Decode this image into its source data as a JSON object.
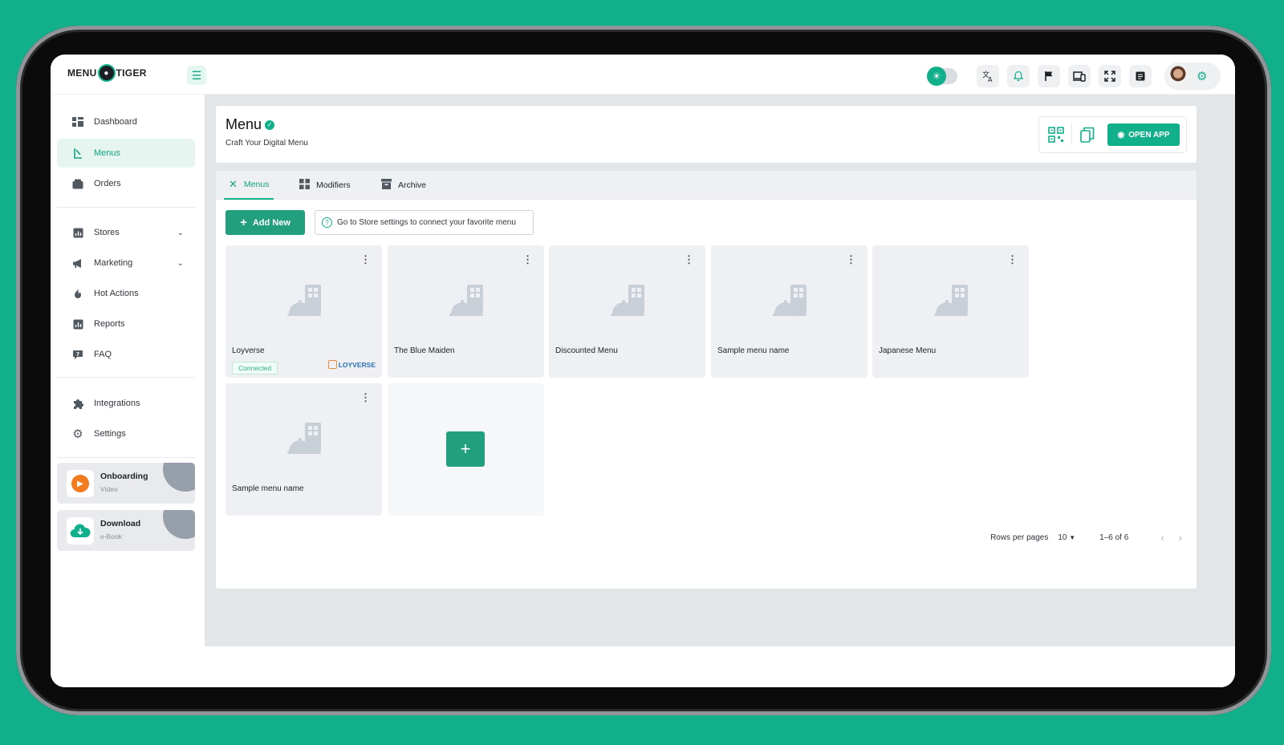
{
  "app": {
    "logo_left": "MENU",
    "logo_right": "TIGER"
  },
  "topbar": {
    "icons": [
      "theme-toggle",
      "translate-icon",
      "bell-icon",
      "flag-icon",
      "devices-icon",
      "fullscreen-icon",
      "notes-icon",
      "avatar",
      "gear-icon"
    ]
  },
  "sidebar": {
    "items": [
      {
        "label": "Dashboard",
        "icon": "dashboard-icon"
      },
      {
        "label": "Menus",
        "icon": "menu-book-icon",
        "active": true
      },
      {
        "label": "Orders",
        "icon": "orders-icon"
      },
      {
        "label": "Stores",
        "icon": "stores-icon",
        "expandable": true
      },
      {
        "label": "Marketing",
        "icon": "megaphone-icon",
        "expandable": true
      },
      {
        "label": "Hot Actions",
        "icon": "fire-icon"
      },
      {
        "label": "Reports",
        "icon": "reports-icon"
      },
      {
        "label": "FAQ",
        "icon": "faq-icon"
      },
      {
        "label": "Integrations",
        "icon": "puzzle-icon"
      },
      {
        "label": "Settings",
        "icon": "gear-icon"
      }
    ],
    "promos": [
      {
        "title": "Onboarding",
        "subtitle": "Video",
        "color": "#f47a20"
      },
      {
        "title": "Download",
        "subtitle": "e-Book",
        "color": "#12b08a"
      }
    ]
  },
  "header": {
    "title": "Menu",
    "subtitle": "Craft Your Digital Menu",
    "open_app_label": "OPEN APP"
  },
  "tabs": [
    {
      "label": "Menus",
      "active": true
    },
    {
      "label": "Modifiers"
    },
    {
      "label": "Archive"
    }
  ],
  "toolbar": {
    "add_new_label": "Add New",
    "hint": "Go to Store settings to connect your favorite menu"
  },
  "menus": [
    {
      "name": "Loyverse",
      "status": "Connected",
      "integration": "LOYVERSE"
    },
    {
      "name": "The Blue Maiden"
    },
    {
      "name": "Discounted Menu"
    },
    {
      "name": "Sample menu name"
    },
    {
      "name": "Japanese Menu"
    },
    {
      "name": "Sample menu name"
    }
  ],
  "pagination": {
    "rows_label": "Rows per pages",
    "rows_value": "10",
    "range": "1–6 of 6"
  },
  "colors": {
    "accent": "#12b08a",
    "button": "#22a07e",
    "background": "#12b08a"
  }
}
